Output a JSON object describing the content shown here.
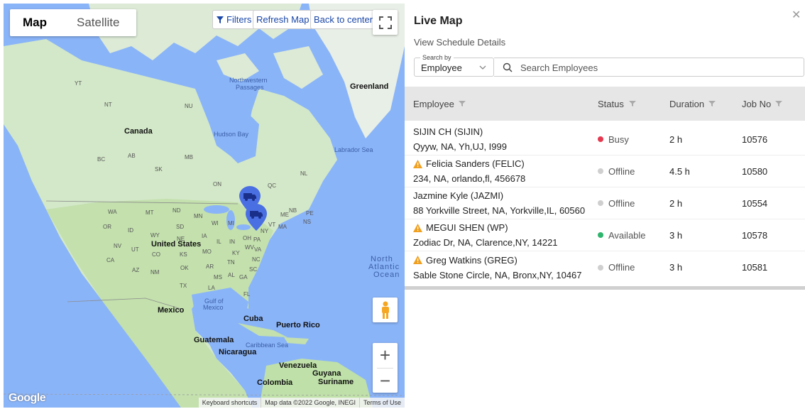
{
  "map": {
    "type_map": "Map",
    "type_satellite": "Satellite",
    "filters": "Filters",
    "refresh": "Refresh Map",
    "back_to_center": "Back to center",
    "zoom_in": "+",
    "zoom_out": "−",
    "google": "Google",
    "attribution": [
      "Keyboard shortcuts",
      "Map data ©2022 Google, INEGI",
      "Terms of Use"
    ],
    "labels": {
      "greenland": "Greenland",
      "canada": "Canada",
      "hudson_bay": "Hudson Bay",
      "labrador_sea": "Labrador Sea",
      "nw_passages_1": "Northwestern",
      "nw_passages_2": "Passages",
      "united_states": "United States",
      "mexico": "Mexico",
      "gulf_1": "Gulf of",
      "gulf_2": "Mexico",
      "cuba": "Cuba",
      "puerto_rico": "Puerto Rico",
      "guatemala": "Guatemala",
      "nicaragua": "Nicaragua",
      "caribbean": "Caribbean Sea",
      "venezuela": "Venezuela",
      "guyana": "Guyana",
      "suriname": "Suriname",
      "colombia": "Colombia",
      "ocean_1": "North",
      "ocean_2": "Atlantic",
      "ocean_3": "Ocean",
      "nt": "NT",
      "yt": "YT",
      "nu": "NU",
      "ab": "AB",
      "bc": "BC",
      "sk": "SK",
      "mb": "MB",
      "on": "ON",
      "qc": "QC",
      "nl": "NL",
      "nb": "NB",
      "ns": "NS",
      "pe": "PE",
      "wa": "WA",
      "or": "OR",
      "id": "ID",
      "mt": "MT",
      "nd": "ND",
      "mn": "MN",
      "wi": "WI",
      "mi": "MI",
      "ny": "NY",
      "me": "ME",
      "wy": "WY",
      "sd": "SD",
      "ne": "NE",
      "ia": "IA",
      "il": "IL",
      "in": "IN",
      "oh": "OH",
      "pa": "PA",
      "nv": "NV",
      "ut": "UT",
      "co": "CO",
      "ks": "KS",
      "mo": "MO",
      "ky": "KY",
      "wv": "WV",
      "va": "VA",
      "ca": "CA",
      "az": "AZ",
      "nm": "NM",
      "ok": "OK",
      "tn": "TN",
      "nc": "NC",
      "ar": "AR",
      "ms": "MS",
      "al": "AL",
      "ga": "GA",
      "sc": "SC",
      "tx": "TX",
      "la": "LA",
      "fl": "FL",
      "ma": "MA",
      "vt": "VT"
    }
  },
  "panel": {
    "title": "Live Map",
    "schedule_link": "View Schedule Details",
    "search_by_label": "Search by",
    "search_by_value": "Employee",
    "search_placeholder": "Search Employees",
    "columns": {
      "employee": "Employee",
      "status": "Status",
      "duration": "Duration",
      "job_no": "Job No"
    },
    "rows": [
      {
        "name": "SIJIN CH (SIJIN)",
        "address": "Qyyw, NA, Yh,UJ, I999",
        "warning": false,
        "status": "Busy",
        "status_color": "#e53950",
        "duration": "2 h",
        "job": "10576"
      },
      {
        "name": "Felicia Sanders (FELIC)",
        "address": "234, NA, orlando,fl, 456678",
        "warning": true,
        "status": "Offline",
        "status_color": "#cfcfcf",
        "duration": "4.5 h",
        "job": "10580"
      },
      {
        "name": "Jazmine Kyle (JAZMI)",
        "address": "88 Yorkville Street, NA, Yorkville,IL, 60560",
        "warning": false,
        "status": "Offline",
        "status_color": "#cfcfcf",
        "duration": "2 h",
        "job": "10554"
      },
      {
        "name": "MEGUI SHEN (WP)",
        "address": "Zodiac Dr, NA, Clarence,NY, 14221",
        "warning": true,
        "status": "Available",
        "status_color": "#2fb56d",
        "duration": "3 h",
        "job": "10578"
      },
      {
        "name": "Greg Watkins (GREG)",
        "address": "Sable Stone Circle, NA, Bronx,NY, 10467",
        "warning": true,
        "status": "Offline",
        "status_color": "#cfcfcf",
        "duration": "3 h",
        "job": "10581"
      }
    ]
  },
  "colors": {
    "water": "#8ab4f8",
    "land_north": "#d8ead2",
    "land_south": "#c7e3b4",
    "marker": "#4a6fe3",
    "link": "#1a47a8"
  }
}
